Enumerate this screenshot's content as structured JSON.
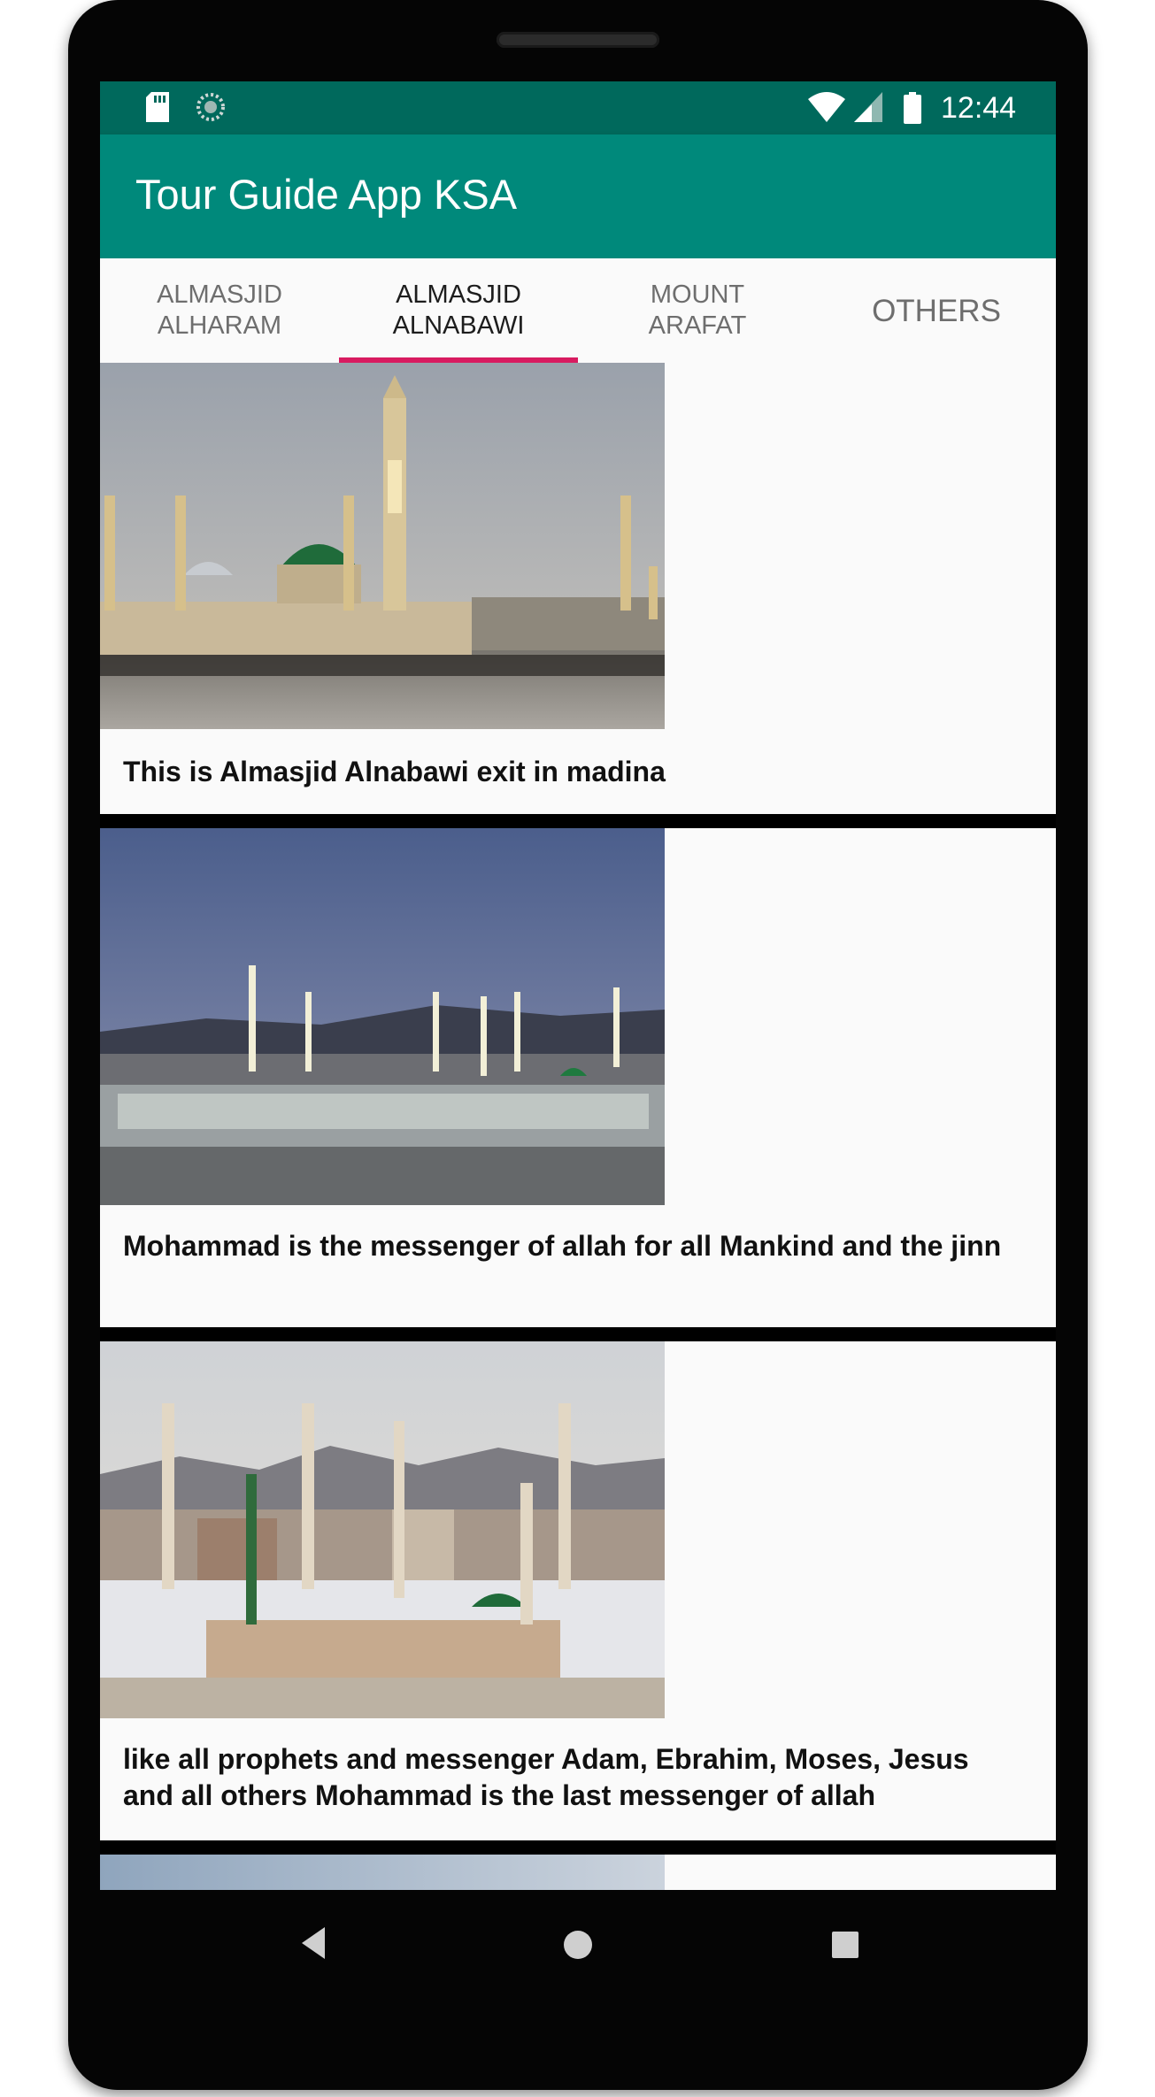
{
  "status_bar": {
    "time": "12:44",
    "icons": [
      "sd-card-icon",
      "sync-icon",
      "wifi-icon",
      "signal-icon",
      "battery-icon"
    ]
  },
  "app_bar": {
    "title": "Tour Guide App KSA",
    "color": "#00897b"
  },
  "tabs": [
    {
      "label": "ALMASJID\nALHARAM",
      "active": false
    },
    {
      "label": "ALMASJID\nALNABAWI",
      "active": true
    },
    {
      "label": "MOUNT\nARAFAT",
      "active": false
    },
    {
      "label": "OTHERS",
      "active": false
    }
  ],
  "accent_color": "#d81b60",
  "list": {
    "items": [
      {
        "image": "mosque-dusk-photo",
        "caption": "This is Almasjid Alnabawi exit in madina"
      },
      {
        "image": "mosque-aerial-night-photo",
        "caption": "Mohammad is the messenger of allah for all Mankind and the jinn"
      },
      {
        "image": "mosque-daylight-mountains-photo",
        "caption": "like all prophets and messenger Adam, Ebrahim, Moses, Jesus and all others Mohammad is the last messenger of allah"
      },
      {
        "image": "partially-visible-photo",
        "caption": ""
      }
    ]
  },
  "nav_bar": {
    "icons": [
      "back-icon",
      "home-icon",
      "recents-icon"
    ]
  }
}
